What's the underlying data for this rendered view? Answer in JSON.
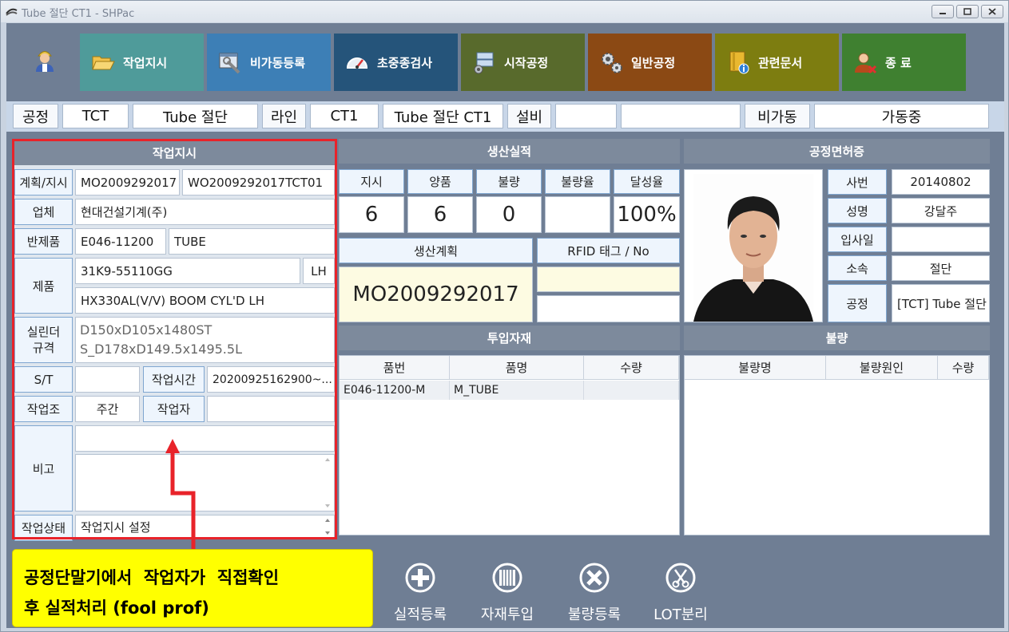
{
  "window": {
    "title": "Tube 절단 CT1 - SHPac"
  },
  "nav": {
    "items": [
      {
        "label": "작업지시",
        "color": "#4f9b9a",
        "icon": "folder-open-icon"
      },
      {
        "label": "비가동등록",
        "color": "#3d7fb6",
        "icon": "wrench-window-icon"
      },
      {
        "label": "초중종검사",
        "color": "#25547a",
        "icon": "gauge-icon"
      },
      {
        "label": "시작공정",
        "color": "#586a2c",
        "icon": "server-gear-icon"
      },
      {
        "label": "일반공정",
        "color": "#8b4914",
        "icon": "gears-icon"
      },
      {
        "label": "관련문서",
        "color": "#7d7d10",
        "icon": "book-info-icon"
      },
      {
        "label": "종 료",
        "color": "#3f8030",
        "icon": "user-exit-icon"
      }
    ]
  },
  "info": {
    "process_label": "공정",
    "process_code": "TCT",
    "process_name": "Tube 절단",
    "line_label": "라인",
    "line_code": "CT1",
    "line_name": "Tube 절단 CT1",
    "equipment_label": "설비",
    "equipment_code": "",
    "equipment_name": "",
    "downtime_label": "비가동",
    "status": "가동중"
  },
  "work_order": {
    "header": "작업지시",
    "plan_label": "계획/지시",
    "plan_no": "MO2009292017",
    "order_no": "WO2009292017TCT01",
    "company_label": "업체",
    "company": "현대건설기계(주)",
    "semi_label": "반제품",
    "semi_code": "E046-11200",
    "semi_name": "TUBE",
    "product_label": "제품",
    "product_code": "31K9-55110GG",
    "product_side": "LH",
    "product_name": "HX330AL(V/V) BOOM CYL'D LH",
    "cylinder_label_1": "실린더",
    "cylinder_label_2": "규격",
    "cylinder_spec_1": "D150xD105x1480ST",
    "cylinder_spec_2": "S_D178xD149.5x1495.5L",
    "st_label": "S/T",
    "st_value": "",
    "work_time_label": "작업시간",
    "work_time": "20200925162900~...",
    "shift_label": "작업조",
    "shift": "주간",
    "worker_label": "작업자",
    "worker": "",
    "remarks_label": "비고",
    "remarks_1": "",
    "remarks_2": "",
    "state_label": "작업상태",
    "state": "작업지시 설정"
  },
  "production": {
    "header": "생산실적",
    "col_order": "지시",
    "col_good": "양품",
    "col_bad": "불량",
    "col_bad_rate": "불량율",
    "col_achieve": "달성율",
    "order": "6",
    "good": "6",
    "bad": "0",
    "bad_rate": "",
    "achieve": "100%",
    "plan_label": "생산계획",
    "rfid_label": "RFID 태그 / No",
    "plan_no": "MO2009292017",
    "rfid_tag": "",
    "rfid_no": ""
  },
  "license": {
    "header": "공정면허증",
    "emp_no_label": "사번",
    "emp_no": "20140802",
    "name_label": "성명",
    "name": "강달주",
    "join_label": "입사일",
    "join_date": "",
    "dept_label": "소속",
    "dept": "절단",
    "process_label": "공정",
    "process": "[TCT] Tube 절단"
  },
  "materials": {
    "header": "투입자재",
    "columns": [
      "품번",
      "품명",
      "수량"
    ],
    "rows": [
      {
        "part_no": "E046-11200-M",
        "part_name": "M_TUBE",
        "qty": ""
      }
    ]
  },
  "defects": {
    "header": "불량",
    "columns": [
      "불량명",
      "불량원인",
      "수량"
    ]
  },
  "actions": [
    {
      "label": "실적등록",
      "icon": "plus-circle-icon"
    },
    {
      "label": "자재투입",
      "icon": "book-circle-icon"
    },
    {
      "label": "불량등록",
      "icon": "x-circle-icon"
    },
    {
      "label": "LOT분리",
      "icon": "scissors-circle-icon"
    }
  ],
  "callout": {
    "line1": "공정단말기에서  작업자가  직접확인",
    "line2": "후 실적처리 (fool prof)"
  }
}
